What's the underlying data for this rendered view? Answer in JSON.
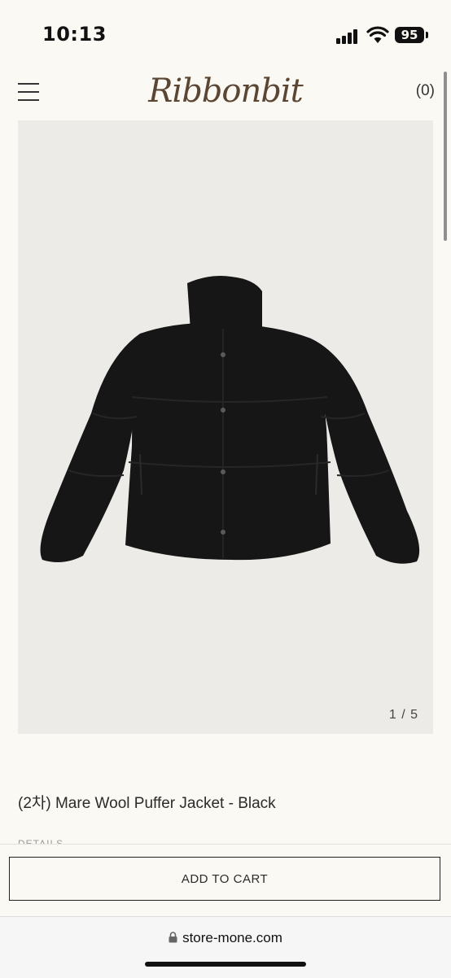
{
  "status_bar": {
    "time": "10:13",
    "battery": "95"
  },
  "header": {
    "brand": "Ribbonbit",
    "cart_count": "(0)"
  },
  "gallery": {
    "counter": "1 / 5",
    "current": 1,
    "total": 5
  },
  "product": {
    "title": "(2차) Mare Wool Puffer Jacket - Black",
    "details_label": "DETAILS"
  },
  "actions": {
    "add_to_cart": "ADD TO CART"
  },
  "browser": {
    "url": "store-mone.com"
  },
  "colors": {
    "background": "#fbf9f4",
    "brand": "#5b4634",
    "image_bg": "#ecebe7"
  }
}
